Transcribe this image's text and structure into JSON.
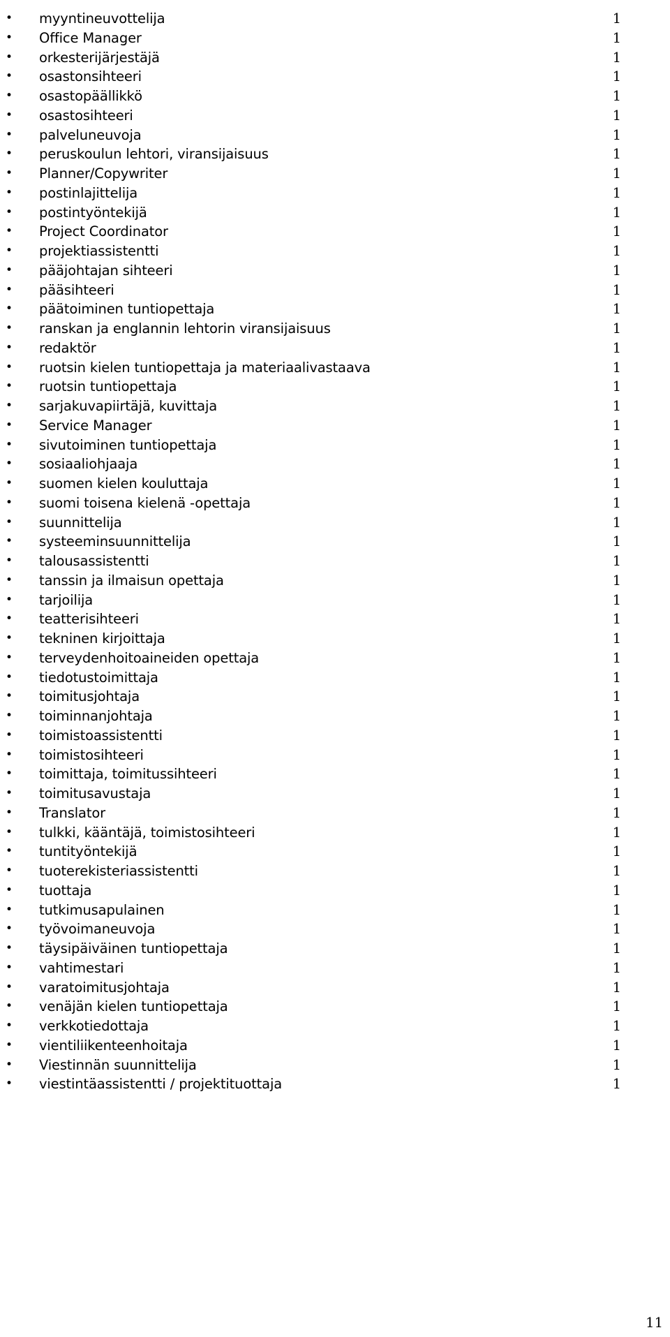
{
  "document": {
    "page_number": "11",
    "bullet_glyph": "•",
    "text_color": "#000000",
    "background_color": "#ffffff"
  },
  "list": {
    "count_column_header": "",
    "items": [
      {
        "label": "myyntineuvottelija",
        "count": "1"
      },
      {
        "label": "Office Manager",
        "count": "1"
      },
      {
        "label": "orkesterijärjestäjä",
        "count": "1"
      },
      {
        "label": "osastonsihteeri",
        "count": "1"
      },
      {
        "label": "osastopäällikkö",
        "count": "1"
      },
      {
        "label": "osastosihteeri",
        "count": "1"
      },
      {
        "label": "palveluneuvoja",
        "count": "1"
      },
      {
        "label": "peruskoulun lehtori, viransijaisuus",
        "count": "1"
      },
      {
        "label": "Planner/Copywriter",
        "count": "1"
      },
      {
        "label": "postinlajittelija",
        "count": "1"
      },
      {
        "label": "postintyöntekijä",
        "count": "1"
      },
      {
        "label": "Project Coordinator",
        "count": "1"
      },
      {
        "label": "projektiassistentti",
        "count": "1"
      },
      {
        "label": "pääjohtajan sihteeri",
        "count": "1"
      },
      {
        "label": "pääsihteeri",
        "count": "1"
      },
      {
        "label": "päätoiminen tuntiopettaja",
        "count": "1"
      },
      {
        "label": "ranskan ja englannin lehtorin viransijaisuus",
        "count": "1"
      },
      {
        "label": "redaktör",
        "count": "1"
      },
      {
        "label": "ruotsin kielen tuntiopettaja ja materiaalivastaava",
        "count": "1"
      },
      {
        "label": "ruotsin tuntiopettaja",
        "count": "1"
      },
      {
        "label": "sarjakuvapiirtäjä, kuvittaja",
        "count": "1"
      },
      {
        "label": "Service Manager",
        "count": "1"
      },
      {
        "label": "sivutoiminen tuntiopettaja",
        "count": "1"
      },
      {
        "label": "sosiaaliohjaaja",
        "count": "1"
      },
      {
        "label": "suomen kielen kouluttaja",
        "count": "1"
      },
      {
        "label": "suomi toisena kielenä -opettaja",
        "count": "1"
      },
      {
        "label": "suunnittelija",
        "count": "1"
      },
      {
        "label": "systeeminsuunnittelija",
        "count": "1"
      },
      {
        "label": "talousassistentti",
        "count": "1"
      },
      {
        "label": "tanssin ja ilmaisun opettaja",
        "count": "1"
      },
      {
        "label": "tarjoilija",
        "count": "1"
      },
      {
        "label": "teatterisihteeri",
        "count": "1"
      },
      {
        "label": "tekninen kirjoittaja",
        "count": "1"
      },
      {
        "label": "terveydenhoitoaineiden opettaja",
        "count": "1"
      },
      {
        "label": "tiedotustoimittaja",
        "count": "1"
      },
      {
        "label": "toimitusjohtaja",
        "count": "1"
      },
      {
        "label": "toiminnanjohtaja",
        "count": "1"
      },
      {
        "label": "toimistoassistentti",
        "count": "1"
      },
      {
        "label": "toimistosihteeri",
        "count": "1"
      },
      {
        "label": "toimittaja, toimitussihteeri",
        "count": "1"
      },
      {
        "label": "toimitusavustaja",
        "count": "1"
      },
      {
        "label": "Translator",
        "count": "1"
      },
      {
        "label": "tulkki, kääntäjä, toimistosihteeri",
        "count": "1"
      },
      {
        "label": "tuntityöntekijä",
        "count": "1"
      },
      {
        "label": "tuoterekisteriassistentti",
        "count": "1"
      },
      {
        "label": "tuottaja",
        "count": "1"
      },
      {
        "label": "tutkimusapulainen",
        "count": "1"
      },
      {
        "label": "työvoimaneuvoja",
        "count": "1"
      },
      {
        "label": "täysipäiväinen tuntiopettaja",
        "count": "1"
      },
      {
        "label": "vahtimestari",
        "count": "1"
      },
      {
        "label": "varatoimitusjohtaja",
        "count": "1"
      },
      {
        "label": "venäjän kielen tuntiopettaja",
        "count": "1"
      },
      {
        "label": "verkkotiedottaja",
        "count": "1"
      },
      {
        "label": "vientiliikenteenhoitaja",
        "count": "1"
      },
      {
        "label": "Viestinnän suunnittelija",
        "count": "1"
      },
      {
        "label": "viestintäassistentti / projektituottaja",
        "count": "1"
      }
    ]
  }
}
